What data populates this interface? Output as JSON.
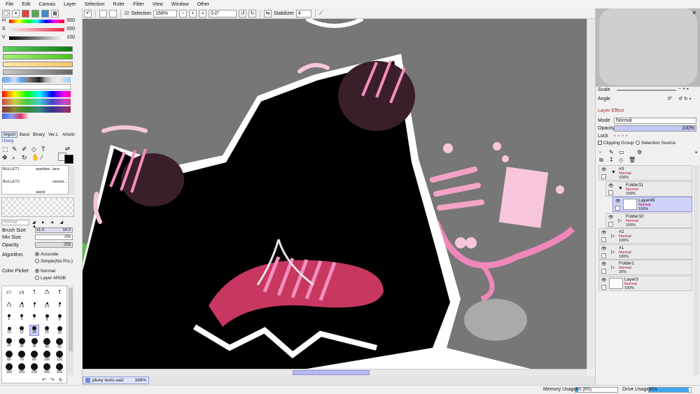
{
  "menu": [
    "File",
    "Edit",
    "Canvas",
    "Layer",
    "Selection",
    "Ruler",
    "Filter",
    "View",
    "Window",
    "Other"
  ],
  "toolbar": {
    "selection_label": "Selection",
    "zoom": "168%",
    "angle": "0.0°",
    "stabilizer_label": "Stabilizer",
    "stabilizer_value": "4"
  },
  "color": {
    "h_label": "H",
    "h_value": "000",
    "s_label": "S",
    "s_value": "000",
    "v_label": "V",
    "v_value": "100",
    "primary": "#000000",
    "secondary": "#ffffff"
  },
  "tool_tabs": [
    "Import",
    "Basic",
    "Binary",
    "Ver.1",
    "Artistic"
  ],
  "tool_tab_selected": "Import",
  "tool_group_label": "Unorg",
  "brushes": [
    "BULLET1",
    "sparkles",
    "lace",
    "BULLET2",
    "censor...",
    "weird"
  ],
  "brush_settings": {
    "mode": "Normal",
    "brush_size_label": "Brush Size",
    "brush_size_mult": "x1.0",
    "brush_size_value": "14.0",
    "min_size_label": "Min Size",
    "min_size_value": "0%",
    "opacity_label": "Opacity",
    "opacity_value": "255",
    "algorithm_label": "Algorithm",
    "algorithm_options": [
      "Accurate",
      "Simple(No Prs.)"
    ],
    "algorithm_selected": "Accurate",
    "color_picker_label": "Color Picker",
    "color_picker_options": [
      "Normal",
      "Layer ARGB"
    ],
    "color_picker_selected": "Normal"
  },
  "brush_sizes": [
    "0.7",
    "0.8",
    "1",
    "1.5",
    "2",
    "2.3",
    "2.6",
    "3",
    "3.5",
    "4",
    "5",
    "6",
    "7",
    "8",
    "9",
    "10",
    "12",
    "14",
    "16",
    "20",
    "25",
    "30",
    "35",
    "40",
    "50",
    "60",
    "70",
    "80",
    "100",
    "120",
    "160",
    "200",
    "250",
    "300",
    "350"
  ],
  "brush_size_selected": "14",
  "navigator": {
    "scale_label": "Scale",
    "angle_label": "Angle",
    "angle_value": "0°"
  },
  "layer_effect": {
    "title": "Layer Effect",
    "mode_label": "Mode",
    "mode_value": "Normal",
    "opacity_label": "Opacity",
    "opacity_value": "100%",
    "lock_label": "Lock",
    "clipping_group": "Clipping Group",
    "selection_source": "Selection Source"
  },
  "layers": [
    {
      "name": "#3",
      "mode": "Normal",
      "opacity": "100%",
      "type": "folder",
      "indent": 0,
      "selected": false
    },
    {
      "name": "Folder11",
      "mode": "Normal",
      "opacity": "100%",
      "type": "folder",
      "indent": 1,
      "selected": false
    },
    {
      "name": "Layer49",
      "mode": "Normal",
      "opacity": "100%",
      "type": "layer",
      "indent": 2,
      "selected": true
    },
    {
      "name": "Folder10",
      "mode": "Normal",
      "opacity": "100%",
      "type": "folder-collapsed",
      "indent": 1,
      "selected": false
    },
    {
      "name": "#2",
      "mode": "Normal",
      "opacity": "100%",
      "type": "folder-collapsed",
      "indent": 0,
      "selected": false
    },
    {
      "name": "#1",
      "mode": "Normal",
      "opacity": "100%",
      "type": "folder-collapsed",
      "indent": 0,
      "selected": false
    },
    {
      "name": "Folder1",
      "mode": "Normal",
      "opacity": "26%",
      "type": "folder-collapsed",
      "indent": 0,
      "selected": false
    },
    {
      "name": "Layer3",
      "mode": "Normal",
      "opacity": "100%",
      "type": "layer",
      "indent": 0,
      "selected": false
    }
  ],
  "document": {
    "name": "pluey tests.sai2",
    "zoom": "168%"
  },
  "status": {
    "memory_label": "Memory Usage",
    "memory_value": "4% (6%)",
    "memory_fraction": 0.06,
    "drive_label": "Drive Usage",
    "drive_value": "95%",
    "drive_fraction": 0.95
  }
}
